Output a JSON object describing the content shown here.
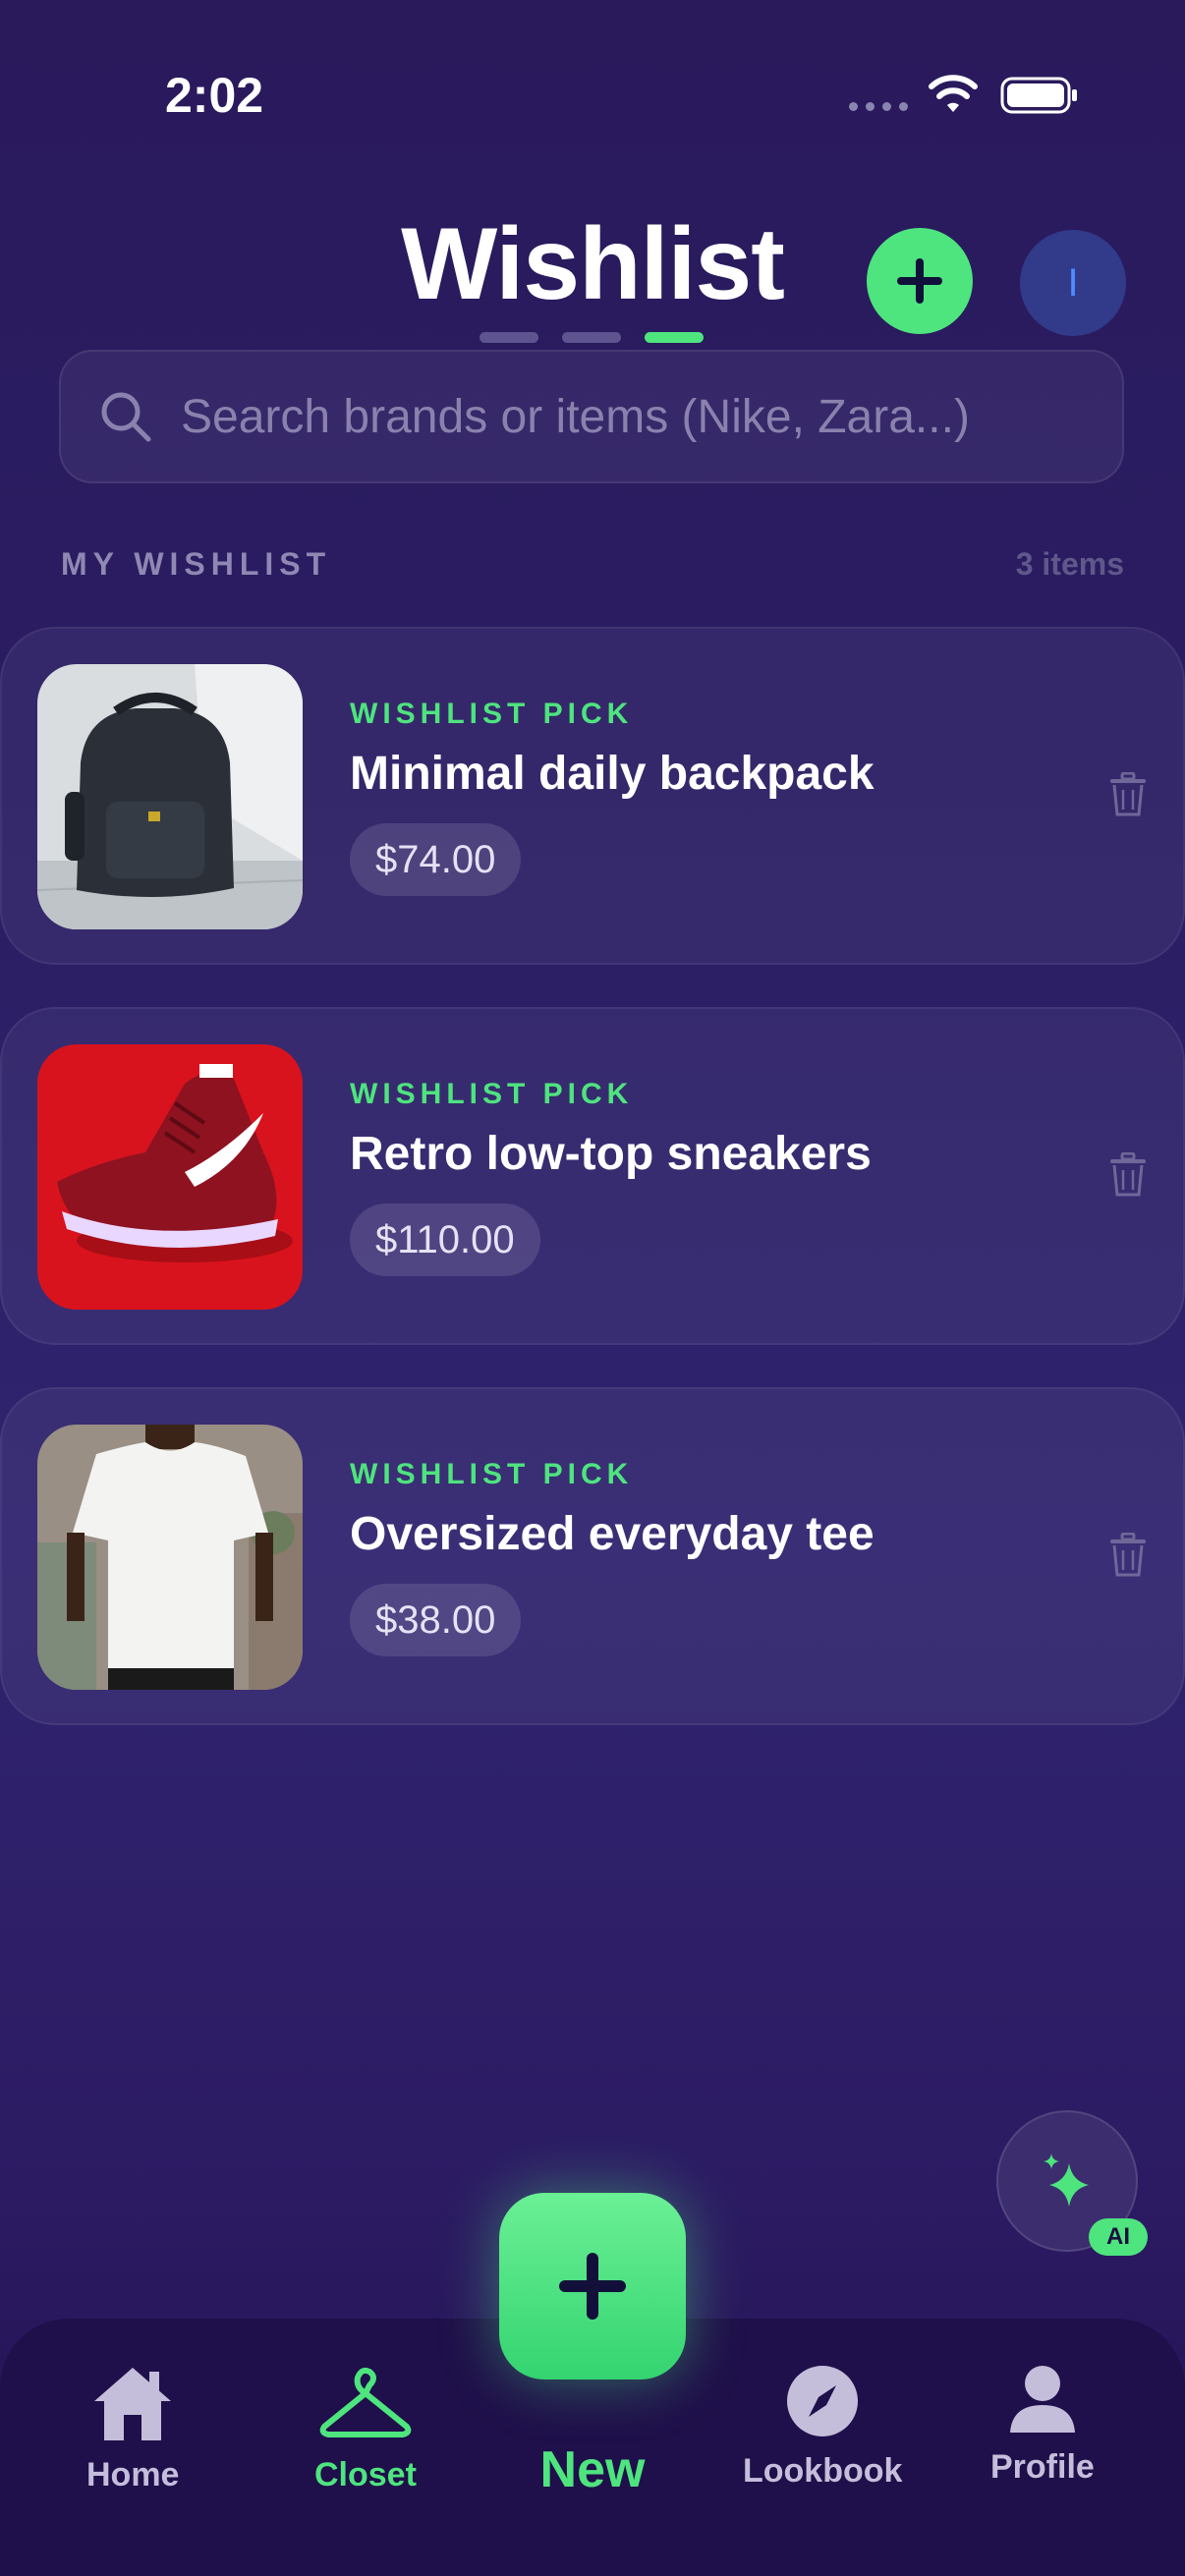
{
  "status_bar": {
    "time": "2:02"
  },
  "header": {
    "title": "Wishlist",
    "avatar_initial": "I"
  },
  "search": {
    "placeholder": "Search brands or items (Nike, Zara...)"
  },
  "section": {
    "label": "MY WISHLIST",
    "count": "3 items"
  },
  "items": [
    {
      "tag": "WISHLIST PICK",
      "name": "Minimal daily backpack",
      "price": "$74.00",
      "image": "backpack"
    },
    {
      "tag": "WISHLIST PICK",
      "name": "Retro low-top sneakers",
      "price": "$110.00",
      "image": "sneaker"
    },
    {
      "tag": "WISHLIST PICK",
      "name": "Oversized everyday tee",
      "price": "$38.00",
      "image": "tee"
    }
  ],
  "ai": {
    "badge": "AI"
  },
  "nav": {
    "home": "Home",
    "closet": "Closet",
    "new": "New",
    "lookbook": "Lookbook",
    "profile": "Profile"
  },
  "colors": {
    "accent": "#4ee47e",
    "background": "#2b1d63"
  }
}
